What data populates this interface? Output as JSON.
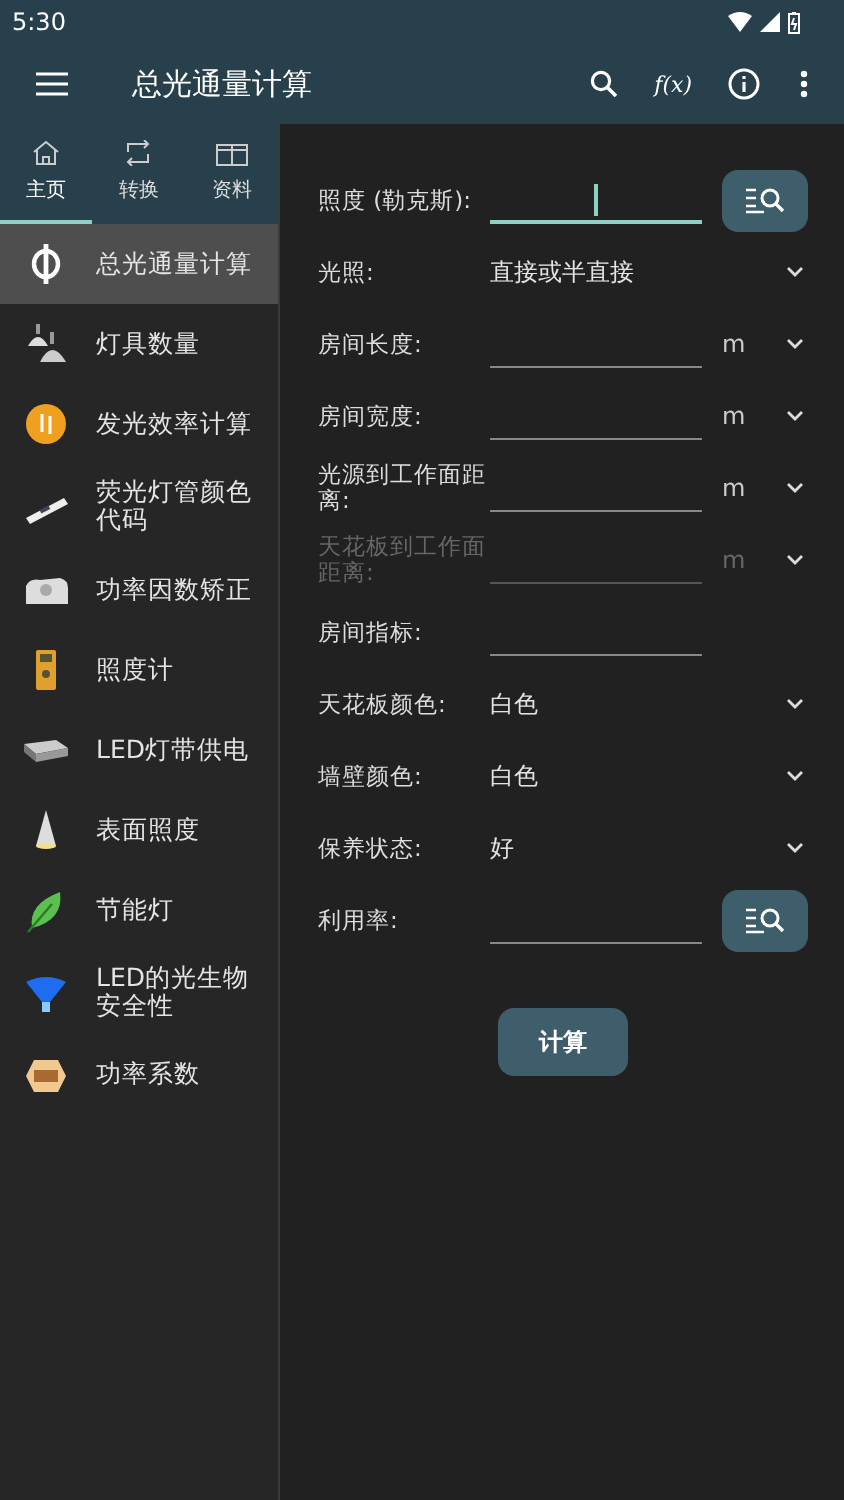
{
  "status_bar": {
    "time": "5:30"
  },
  "app_bar": {
    "title": "总光通量计算",
    "function_icon": "f(x)"
  },
  "tabs": [
    {
      "label": "主页",
      "selected": true
    },
    {
      "label": "转换",
      "selected": false
    },
    {
      "label": "资料",
      "selected": false
    }
  ],
  "sidebar": {
    "items": [
      {
        "label": "总光通量计算",
        "selected": true
      },
      {
        "label": "灯具数量",
        "selected": false
      },
      {
        "label": "发光效率计算",
        "selected": false
      },
      {
        "label": "荧光灯管颜色代码",
        "selected": false
      },
      {
        "label": "功率因数矫正",
        "selected": false
      },
      {
        "label": "照度计",
        "selected": false
      },
      {
        "label": "LED灯带供电",
        "selected": false
      },
      {
        "label": "表面照度",
        "selected": false
      },
      {
        "label": "节能灯",
        "selected": false
      },
      {
        "label": "LED的光生物安全性",
        "selected": false
      },
      {
        "label": "功率系数",
        "selected": false
      }
    ]
  },
  "form": {
    "rows": [
      {
        "kind": "input",
        "label": "照度 (勒克斯):",
        "focused": true,
        "disabled": false,
        "lookup": true
      },
      {
        "kind": "select",
        "label": "光照:",
        "value": "直接或半直接",
        "disabled": false
      },
      {
        "kind": "input",
        "label": "房间长度:",
        "unit": "m",
        "focused": false,
        "disabled": false,
        "lookup": false
      },
      {
        "kind": "input",
        "label": "房间宽度:",
        "unit": "m",
        "focused": false,
        "disabled": false,
        "lookup": false
      },
      {
        "kind": "input",
        "label": "光源到工作面距离:",
        "unit": "m",
        "focused": false,
        "disabled": false,
        "lookup": false
      },
      {
        "kind": "input",
        "label": "天花板到工作面距离:",
        "unit": "m",
        "focused": false,
        "disabled": true,
        "lookup": false
      },
      {
        "kind": "input",
        "label": "房间指标:",
        "focused": false,
        "disabled": false,
        "lookup": false
      },
      {
        "kind": "select",
        "label": "天花板颜色:",
        "value": "白色",
        "disabled": false
      },
      {
        "kind": "select",
        "label": "墙壁颜色:",
        "value": "白色",
        "disabled": false
      },
      {
        "kind": "select",
        "label": "保养状态:",
        "value": "好",
        "disabled": false
      },
      {
        "kind": "input",
        "label": "利用率:",
        "focused": false,
        "disabled": false,
        "lookup": true
      }
    ],
    "button": "计算"
  }
}
